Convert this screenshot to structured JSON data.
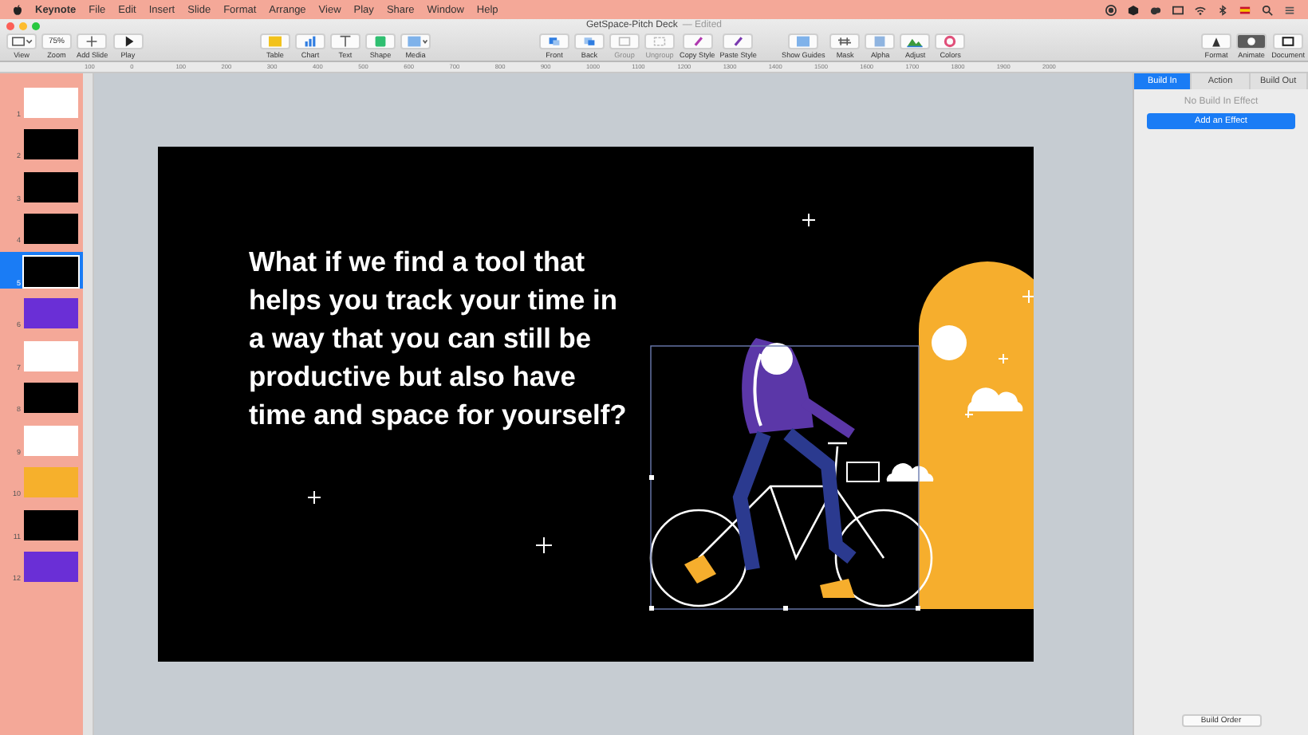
{
  "menu_bar": {
    "app": "Keynote",
    "items": [
      "File",
      "Edit",
      "Insert",
      "Slide",
      "Format",
      "Arrange",
      "View",
      "Play",
      "Share",
      "Window",
      "Help"
    ]
  },
  "window": {
    "title": "GetSpace-Pitch Deck",
    "status": "— Edited"
  },
  "toolbar": {
    "groups": [
      [
        {
          "label": "View",
          "disabled": false,
          "selected": false
        },
        {
          "label": "Zoom",
          "value": "75%",
          "disabled": false,
          "selected": false
        },
        {
          "label": "Add Slide",
          "disabled": false,
          "selected": false
        },
        {
          "label": "Play",
          "disabled": false,
          "selected": false
        }
      ],
      [
        {
          "label": "Table",
          "disabled": false,
          "selected": false
        },
        {
          "label": "Chart",
          "disabled": false,
          "selected": false
        },
        {
          "label": "Text",
          "disabled": false,
          "selected": false
        },
        {
          "label": "Shape",
          "disabled": false,
          "selected": false
        },
        {
          "label": "Media",
          "disabled": false,
          "selected": false
        }
      ],
      [
        {
          "label": "Front",
          "disabled": false,
          "selected": false
        },
        {
          "label": "Back",
          "disabled": false,
          "selected": false
        },
        {
          "label": "Group",
          "disabled": true,
          "selected": false
        },
        {
          "label": "Ungroup",
          "disabled": true,
          "selected": false
        },
        {
          "label": "Copy Style",
          "disabled": false,
          "selected": false
        },
        {
          "label": "Paste Style",
          "disabled": false,
          "selected": false
        }
      ],
      [
        {
          "label": "Show Guides",
          "disabled": false,
          "selected": false
        },
        {
          "label": "Mask",
          "disabled": false,
          "selected": false
        },
        {
          "label": "Alpha",
          "disabled": false,
          "selected": false
        },
        {
          "label": "Adjust",
          "disabled": false,
          "selected": false
        },
        {
          "label": "Colors",
          "disabled": false,
          "selected": false
        }
      ],
      [
        {
          "label": "Format",
          "disabled": false,
          "selected": false
        },
        {
          "label": "Animate",
          "disabled": false,
          "selected": true
        },
        {
          "label": "Document",
          "disabled": false,
          "selected": false
        }
      ]
    ]
  },
  "ruler": {
    "labels": [
      "100",
      "0",
      "100",
      "200",
      "300",
      "400",
      "500",
      "600",
      "700",
      "800",
      "900",
      "1000",
      "1100",
      "1200",
      "1300",
      "1400",
      "1500",
      "1600",
      "1700",
      "1800",
      "1900",
      "2000"
    ]
  },
  "slides": [
    {
      "number": "1",
      "color": "#ffffff",
      "selected": false
    },
    {
      "number": "2",
      "color": "#000000",
      "selected": false
    },
    {
      "number": "3",
      "color": "#000000",
      "selected": false
    },
    {
      "number": "4",
      "color": "#000000",
      "selected": false
    },
    {
      "number": "5",
      "color": "#000000",
      "selected": true
    },
    {
      "number": "6",
      "color": "#6a2fd6",
      "selected": false
    },
    {
      "number": "7",
      "color": "#ffffff",
      "selected": false
    },
    {
      "number": "8",
      "color": "#000000",
      "selected": false
    },
    {
      "number": "9",
      "color": "#ffffff",
      "selected": false
    },
    {
      "number": "10",
      "color": "#f6b02c",
      "selected": false
    },
    {
      "number": "11",
      "color": "#000000",
      "selected": false
    },
    {
      "number": "12",
      "color": "#6a2fd6",
      "selected": false
    }
  ],
  "slide": {
    "headline_lines": [
      "What if we find a tool that",
      "helps you track your time in",
      "a way that you can still be",
      "productive but also have",
      "time and space for yourself?"
    ]
  },
  "inspector": {
    "tabs": [
      {
        "label": "Build In",
        "selected": true
      },
      {
        "label": "Action",
        "selected": false
      },
      {
        "label": "Build Out",
        "selected": false
      }
    ],
    "empty_note": "No Build In Effect",
    "add_button": "Add an Effect",
    "order_button": "Build Order"
  }
}
